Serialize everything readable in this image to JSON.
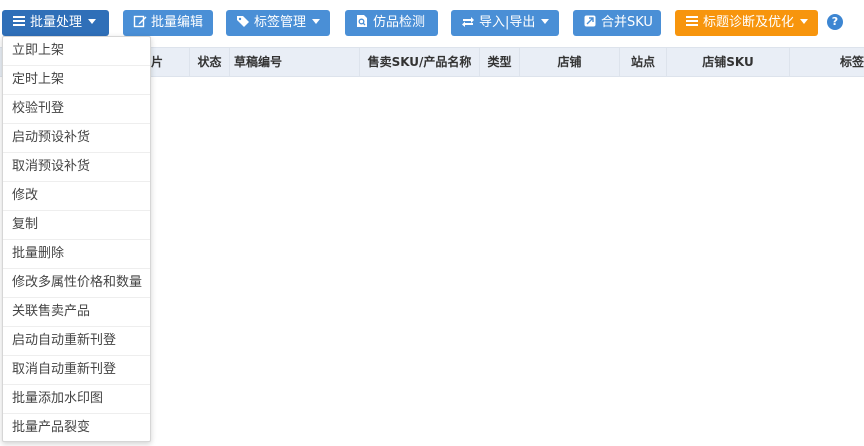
{
  "toolbar": {
    "batch_process": "批量处理",
    "batch_edit": "批量编辑",
    "tag_manage": "标签管理",
    "counterfeit_check": "仿品检测",
    "import_export": "导入|导出",
    "merge_sku": "合并SKU",
    "title_diagnosis": "标题诊断及优化",
    "help": "?"
  },
  "table": {
    "headers": [
      "片",
      "状态",
      "草稿编号",
      "售卖SKU/产品名称",
      "类型",
      "店铺",
      "站点",
      "店铺SKU",
      "标签"
    ]
  },
  "menu": {
    "items": [
      "立即上架",
      "定时上架",
      "校验刊登",
      "启动预设补货",
      "取消预设补货",
      "修改",
      "复制",
      "批量删除",
      "修改多属性价格和数量",
      "关联售卖产品",
      "启动自动重新刊登",
      "取消自动重新刊登",
      "批量添加水印图",
      "批量产品裂变"
    ]
  },
  "colors": {
    "button_blue": "#4a8fd6",
    "button_active": "#2f6fb8",
    "button_orange": "#f7950d",
    "header_bg": "#e9eef6"
  }
}
